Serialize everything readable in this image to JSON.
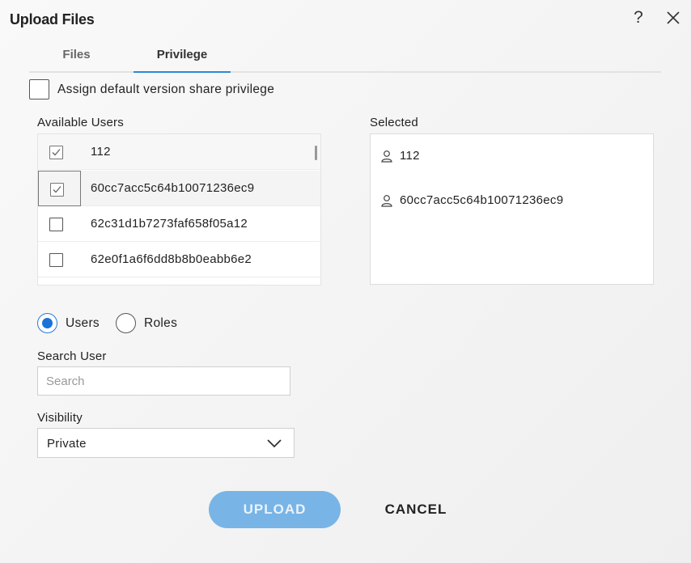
{
  "dialog": {
    "title": "Upload Files",
    "help_icon": "?",
    "icons": {
      "help": "question-icon",
      "close": "close-icon"
    }
  },
  "tabs": [
    {
      "label": "Files",
      "active": false
    },
    {
      "label": "Privilege",
      "active": true
    }
  ],
  "default_privilege": {
    "label": "Assign default version share privilege",
    "checked": false
  },
  "available_users": {
    "label": "Available Users",
    "items": [
      {
        "name": "112",
        "checked": true
      },
      {
        "name": "60cc7acc5c64b10071236ec9",
        "checked": true
      },
      {
        "name": "62c31d1b7273faf658f05a12",
        "checked": false
      },
      {
        "name": "62e0f1a6f6dd8b8b0eabb6e2",
        "checked": false
      }
    ]
  },
  "selected": {
    "label": "Selected",
    "items": [
      {
        "name": "112",
        "icon": "user-icon"
      },
      {
        "name": "60cc7acc5c64b10071236ec9",
        "icon": "user-icon"
      }
    ]
  },
  "mode": {
    "options": [
      {
        "label": "Users",
        "selected": true
      },
      {
        "label": "Roles",
        "selected": false
      }
    ]
  },
  "search": {
    "label": "Search User",
    "placeholder": "Search",
    "value": ""
  },
  "visibility": {
    "label": "Visibility",
    "value": "Private"
  },
  "actions": {
    "upload_label": "UPLOAD",
    "cancel_label": "CANCEL"
  },
  "colors": {
    "accent": "#1a73d9",
    "upload_button": "#78b4e6",
    "tab_underline": "#2a8ad8"
  }
}
